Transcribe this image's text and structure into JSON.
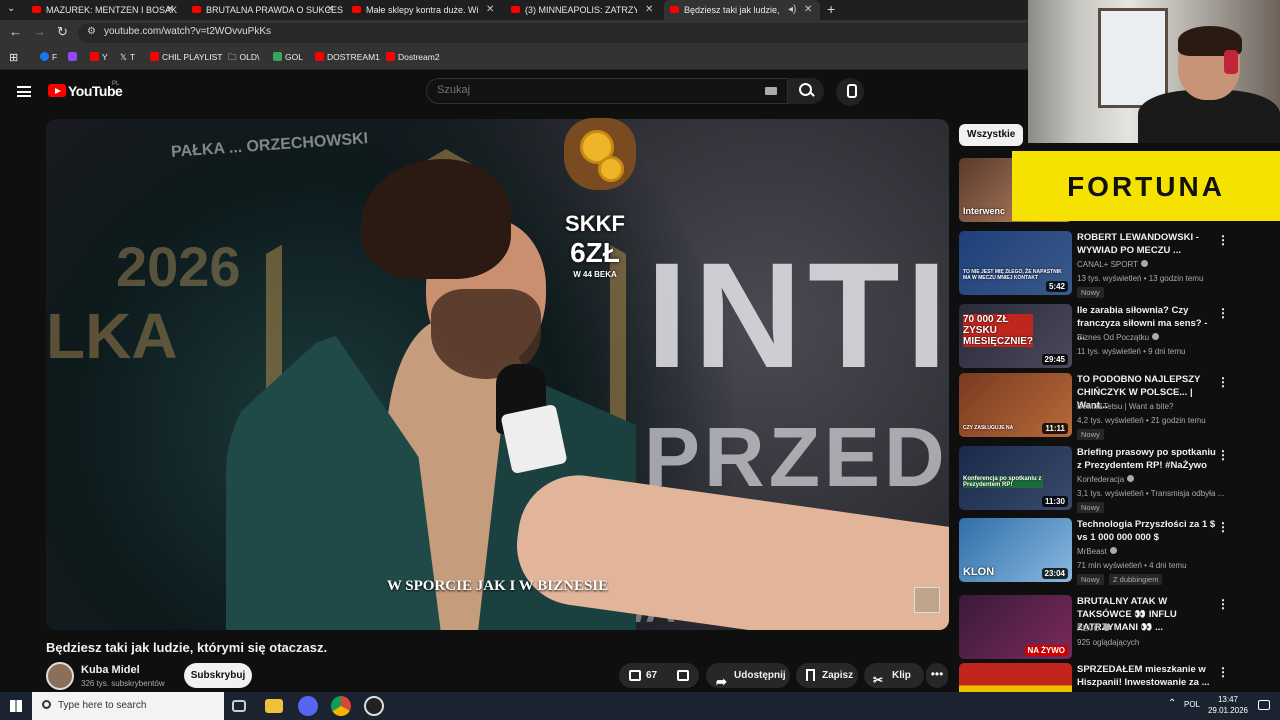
{
  "browser": {
    "tabs": [
      {
        "title": "MAZUREK: MENTZEN I BOSAK",
        "active": false
      },
      {
        "title": "BRUTALNA PRAWDA O SUKCES",
        "active": false
      },
      {
        "title": "Małe sklepy kontra duże. Wida",
        "active": false
      },
      {
        "title": "(3) MINNEAPOLIS: ZATRZYMAN",
        "active": false
      },
      {
        "title": "Będziesz taki jak ludzie, któ",
        "active": true
      }
    ],
    "new_tab_symbol": "+",
    "url": "youtube.com/watch?v=t2WOvvuPkKs",
    "bookmarks": [
      {
        "label": "F",
        "icon": "facebook-icon",
        "color": "#1877f2"
      },
      {
        "label": "",
        "icon": "twitch-icon",
        "color": "#9146ff"
      },
      {
        "label": "Y",
        "icon": "youtube-icon",
        "color": "#ff0000"
      },
      {
        "label": "T",
        "icon": "x-icon",
        "color": "#ffffff"
      },
      {
        "label": "CHIL PLAYLIST",
        "icon": "youtube-icon",
        "color": "#ff0000"
      },
      {
        "label": "OLD\\",
        "icon": "folder-icon",
        "color": "#cccccc"
      },
      {
        "label": "GOL",
        "icon": "gol-icon",
        "color": "#3aa55d"
      },
      {
        "label": "DOSTREAM1",
        "icon": "youtube-icon",
        "color": "#ff0000"
      },
      {
        "label": "Dostream2",
        "icon": "youtube-icon",
        "color": "#ff0000"
      }
    ]
  },
  "youtube": {
    "wordmark": "YouTube",
    "region": "PL",
    "search_placeholder": "Szukaj"
  },
  "video": {
    "subtitle": "W SPORCIE JAK I W BIZNESIE",
    "bg_words": [
      "2026",
      "LKA",
      "INTI",
      "PRZED",
      "PAŁKA ... ORZECHOWSKI",
      "WA"
    ],
    "title": "Będziesz taki jak ludzie, którymi się otaczasz.",
    "channel_name": "Kuba Midel",
    "channel_subs": "326 tys. subskrybentów",
    "subscribe_label": "Subskrybuj",
    "likes": "67",
    "share_label": "Udostępnij",
    "save_label": "Zapisz",
    "clip_label": "Klip",
    "more_symbol": "•••"
  },
  "donation": {
    "donor_code": "SKKF",
    "amount": "6ZŁ",
    "recipient": "W 44 BEKA"
  },
  "sidebar": {
    "chip_all": "Wszystkie",
    "first_thumb_text": "Interwenc",
    "recs": [
      {
        "title": "ROBERT LEWANDOWSKI - WYWIAD PO MECZU ...",
        "channel": "CANAL+ SPORT",
        "verified": true,
        "meta": "13 tys. wyświetleń • 13 godzin temu",
        "badge": "Nowy",
        "duration": "5:42",
        "thumb_text": "TO NIE JEST MIĘ ZŁEGO, ŻE NAPASTNIK MA W MECZU MNIEJ KONTAKT",
        "thumb_color": "#1f3f7a"
      },
      {
        "title": "Ile zarabia siłownia? Czy franczyza siłowni ma sens? - ...",
        "channel": "Biznes Od Początku",
        "verified": true,
        "meta": "11 tys. wyświetleń • 9 dni temu",
        "badge": "",
        "duration": "29:45",
        "thumb_text": "70 000 ZŁ ZYSKU MIESIĘCZNIE?",
        "thumb_color": "#2a2a3a"
      },
      {
        "title": "TO PODOBNO NAJLEPSZY CHIŃCZYK W POLSCE... | Want...",
        "channel": "Beata&Tetsu | Want a bite?",
        "verified": false,
        "meta": "4,2 tys. wyświetleń • 21 godzin temu",
        "badge": "Nowy",
        "duration": "11:11",
        "thumb_text": "CZY ZASŁUGUJE NA",
        "thumb_color": "#7a3a20"
      },
      {
        "title": "Briefing prasowy po spotkaniu z Prezydentem RP! #NaŻywo",
        "channel": "Konfederacja",
        "verified": true,
        "meta": "3,1 tys. wyświetleń • Transmisja odbyła ...",
        "badge": "Nowy",
        "duration": "11:30",
        "thumb_text": "Konferencja po spotkaniu z Prezydentem RP!",
        "thumb_color": "#1a2a4a"
      },
      {
        "title": "Technologia Przyszłości za 1 $ vs 1 000 000 000 $",
        "channel": "MrBeast",
        "verified": true,
        "meta": "71 mln wyświetleń • 4 dni temu",
        "badge": "Nowy",
        "badge2": "Z dubbingiem",
        "duration": "23:04",
        "thumb_text": "KLON",
        "thumb_color": "#2f6fa8"
      },
      {
        "title": "BRUTALNY ATAK W TAKSÓWCE 👀 INFLU ZATRZYMANI 👀 ...",
        "channel": "REVO",
        "verified": true,
        "meta": "925 oglądających",
        "badge": "",
        "duration": "NA ŻYWO",
        "thumb_text": "",
        "thumb_color": "#3a1a3a"
      },
      {
        "title": "SPRZEDAŁEM mieszkanie w Hiszpanii! Inwestowanie za ...",
        "channel": "",
        "verified": false,
        "meta": "",
        "badge": "",
        "duration": "",
        "thumb_text": "",
        "thumb_color": "#c0261e"
      }
    ]
  },
  "overlay": {
    "sponsor": "FORTUNA"
  },
  "taskbar": {
    "search_placeholder": "Type here to search",
    "lang": "POL",
    "time": "13:47",
    "date": "29.01.2026"
  },
  "colors": {
    "youtube_red": "#ff0000",
    "fortuna_yellow": "#f5e200",
    "bg": "#0f0f0f"
  }
}
